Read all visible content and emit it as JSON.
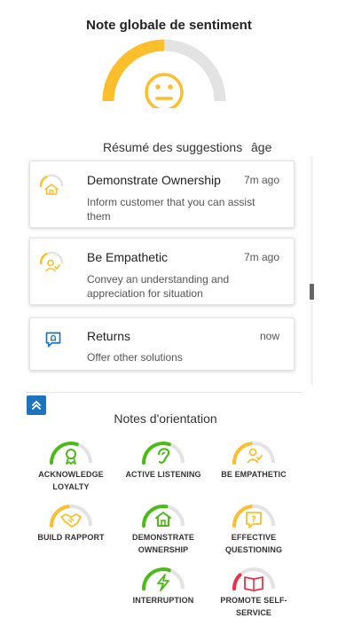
{
  "header": {
    "title": "Note globale de sentiment"
  },
  "sentiment": {
    "level": 0.5,
    "accent": "#fbbf2c",
    "track": "#e3e3e3",
    "face": "neutral-face-icon"
  },
  "suggestions": {
    "title": "Résumé des suggestions",
    "trailing": "âge",
    "items": [
      {
        "title": "Demonstrate Ownership",
        "time": "7m ago",
        "desc": "Inform customer that you can assist them",
        "icon": "house-icon",
        "progress": 0.35,
        "color": "#fbbf2c"
      },
      {
        "title": "Be Empathetic",
        "time": "7m ago",
        "desc": "Convey an understanding and appreciation for situation",
        "icon": "person-check-icon",
        "progress": 0.35,
        "color": "#fbbf2c"
      },
      {
        "title": "Returns",
        "time": "now",
        "desc": "Offer other solutions",
        "icon": "chat-alert-icon",
        "progress": 0,
        "color": "#1e73be"
      }
    ]
  },
  "guidance": {
    "title": "Notes d'orientation",
    "badges": [
      {
        "label": "ACKNOWLEDGE LOYALTY",
        "icon": "ribbon-icon",
        "color": "#4cbb17",
        "progress": 0.6
      },
      {
        "label": "ACTIVE LISTENING",
        "icon": "ear-icon",
        "color": "#4cbb17",
        "progress": 0.6
      },
      {
        "label": "BE EMPATHETIC",
        "icon": "person-check-icon",
        "color": "#fbbf2c",
        "progress": 0.45
      },
      {
        "label": "BUILD RAPPORT",
        "icon": "handshake-icon",
        "color": "#fbbf2c",
        "progress": 0.45
      },
      {
        "label": "DEMONSTRATE OWNERSHIP",
        "icon": "house-icon",
        "color": "#4cbb17",
        "progress": 0.55
      },
      {
        "label": "EFFECTIVE QUESTIONING",
        "icon": "question-bubble-icon",
        "color": "#fbbf2c",
        "progress": 0.45
      },
      {
        "label": "INTERRUPTION",
        "icon": "lightning-icon",
        "color": "#4cbb17",
        "progress": 0.6
      },
      {
        "label": "PROMOTE SELF-SERVICE",
        "icon": "book-icon",
        "color": "#e8334a",
        "progress": 0.25
      }
    ]
  }
}
